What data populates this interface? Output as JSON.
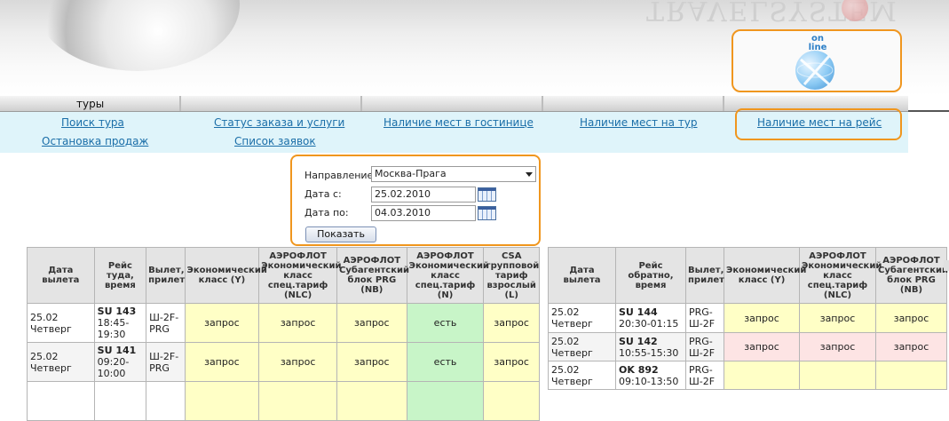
{
  "header": {
    "brand_text": "TRAVELSYSTEM",
    "online_line1": "on",
    "online_line2": "line"
  },
  "tabs": [
    {
      "label": "туры"
    },
    {
      "label": ""
    },
    {
      "label": ""
    },
    {
      "label": ""
    },
    {
      "label": ""
    }
  ],
  "subnav": {
    "row1": [
      "Поиск тура",
      "Статус заказа и услуги",
      "Наличие мест в гостинице",
      "Наличие мест на тур",
      "Наличие мест на рейс"
    ],
    "row2": [
      "Остановка продаж",
      "Список заявок"
    ]
  },
  "form": {
    "direction_label": "Направление:",
    "direction_value": "Москва-Прага",
    "date_from_label": "Дата с:",
    "date_from_value": "25.02.2010",
    "date_to_label": "Дата по:",
    "date_to_value": "04.03.2010",
    "show_button": "Показать"
  },
  "outbound": {
    "headers": [
      "Дата вылета",
      "Рейс туда, время",
      "Вылет, прилет",
      "Экономический класс (Y)",
      "АЭРОФЛОТ Экономический класс спец.тариф (NLC)",
      "АЭРОФЛОТ Субагентский блок PRG (NB)",
      "АЭРОФЛОТ Экономический класс спец.тариф (N)",
      "CSA групповой тариф взрослый (L)"
    ],
    "rows": [
      {
        "date": "25.02",
        "day": "Четверг",
        "flight": "SU 143",
        "time1": "18:45-",
        "time2": "19:30",
        "route1": "Ш-2F-",
        "route2": "PRG",
        "seats": [
          "запрос",
          "запрос",
          "запрос",
          "есть",
          "запрос"
        ]
      },
      {
        "date": "25.02",
        "day": "Четверг",
        "flight": "SU 141",
        "time1": "09:20-",
        "time2": "10:00",
        "route1": "Ш-2F-",
        "route2": "PRG",
        "seats": [
          "запрос",
          "запрос",
          "запрос",
          "есть",
          "запрос"
        ]
      },
      {
        "date": "",
        "day": "",
        "flight": "",
        "time1": "",
        "time2": "",
        "route1": "",
        "route2": "",
        "seats": [
          "",
          "",
          "",
          "",
          ""
        ]
      }
    ]
  },
  "return": {
    "headers": [
      "Дата вылета",
      "Рейс обратно, время",
      "Вылет, прилет",
      "Экономический класс (Y)",
      "АЭРОФЛОТ Экономический класс спец.тариф (NLC)",
      "АЭРОФЛОТ Субагентский блок PRG (NB)"
    ],
    "rows": [
      {
        "date": "25.02",
        "day": "Четверг",
        "flight": "SU 144",
        "time": "20:30-01:15",
        "route1": "PRG-",
        "route2": "Ш-2F",
        "seats": [
          "запрос",
          "запрос",
          "запрос"
        ]
      },
      {
        "date": "25.02",
        "day": "Четверг",
        "flight": "SU 142",
        "time": "10:55-15:30",
        "route1": "PRG-",
        "route2": "Ш-2F",
        "seats": [
          "запрос",
          "запрос",
          "запрос"
        ]
      },
      {
        "date": "25.02",
        "day": "Четверг",
        "flight": "OK 892",
        "time": "09:10-13:50",
        "route1": "PRG-",
        "route2": "Ш-2F",
        "seats": [
          "",
          "",
          ""
        ]
      }
    ]
  }
}
